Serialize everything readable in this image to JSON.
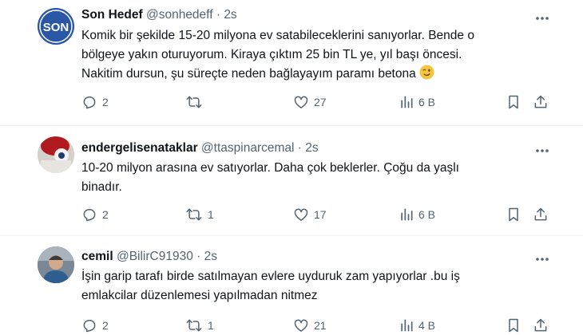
{
  "tweets": [
    {
      "name": "Son Hedef",
      "handle": "@sonhedeff",
      "dot": "·",
      "time": "2s",
      "avatar_text": "SON",
      "lines": [
        "Komik bir şekilde 15-20 milyona ev satabileceklerini sanıyorlar. Bende o",
        "bölgeye yakın oturuyorum. Kiraya çıktım 25 bin TL ye, yıl başı öncesi.",
        "Nakitim dursun, şu süreçte neden bağlayayım paramı betona"
      ],
      "emoji": "winking-face",
      "replies": "2",
      "retweets": "",
      "likes": "27",
      "views": "6 B"
    },
    {
      "name": "endergelisenataklar",
      "handle": "@ttaspinarcemal",
      "dot": "·",
      "time": "2s",
      "lines": [
        "10-20 milyon arasına ev satıyorlar. Daha çok beklerler. Çoğu da yaşlı",
        "binadır."
      ],
      "replies": "2",
      "retweets": "1",
      "likes": "17",
      "views": "6 B"
    },
    {
      "name": "cemil",
      "handle": "@BilirC91930",
      "dot": "·",
      "time": "2s",
      "lines": [
        "İşin garip tarafı birde satılmayan evlere uyduruk zam yapıyorlar .bu iş",
        "emlakcilar düzenlemesi yapılmadan nitmez"
      ],
      "replies": "2",
      "retweets": "1",
      "likes": "21",
      "views": "4 B"
    }
  ],
  "colors": {
    "text": "#0f1419",
    "secondary": "#536471",
    "divider": "#eff3f4",
    "avatar_blue": "#2a56a6"
  },
  "icons": [
    "more-icon",
    "reply-icon",
    "retweet-icon",
    "like-icon",
    "views-icon",
    "bookmark-icon",
    "share-icon"
  ]
}
